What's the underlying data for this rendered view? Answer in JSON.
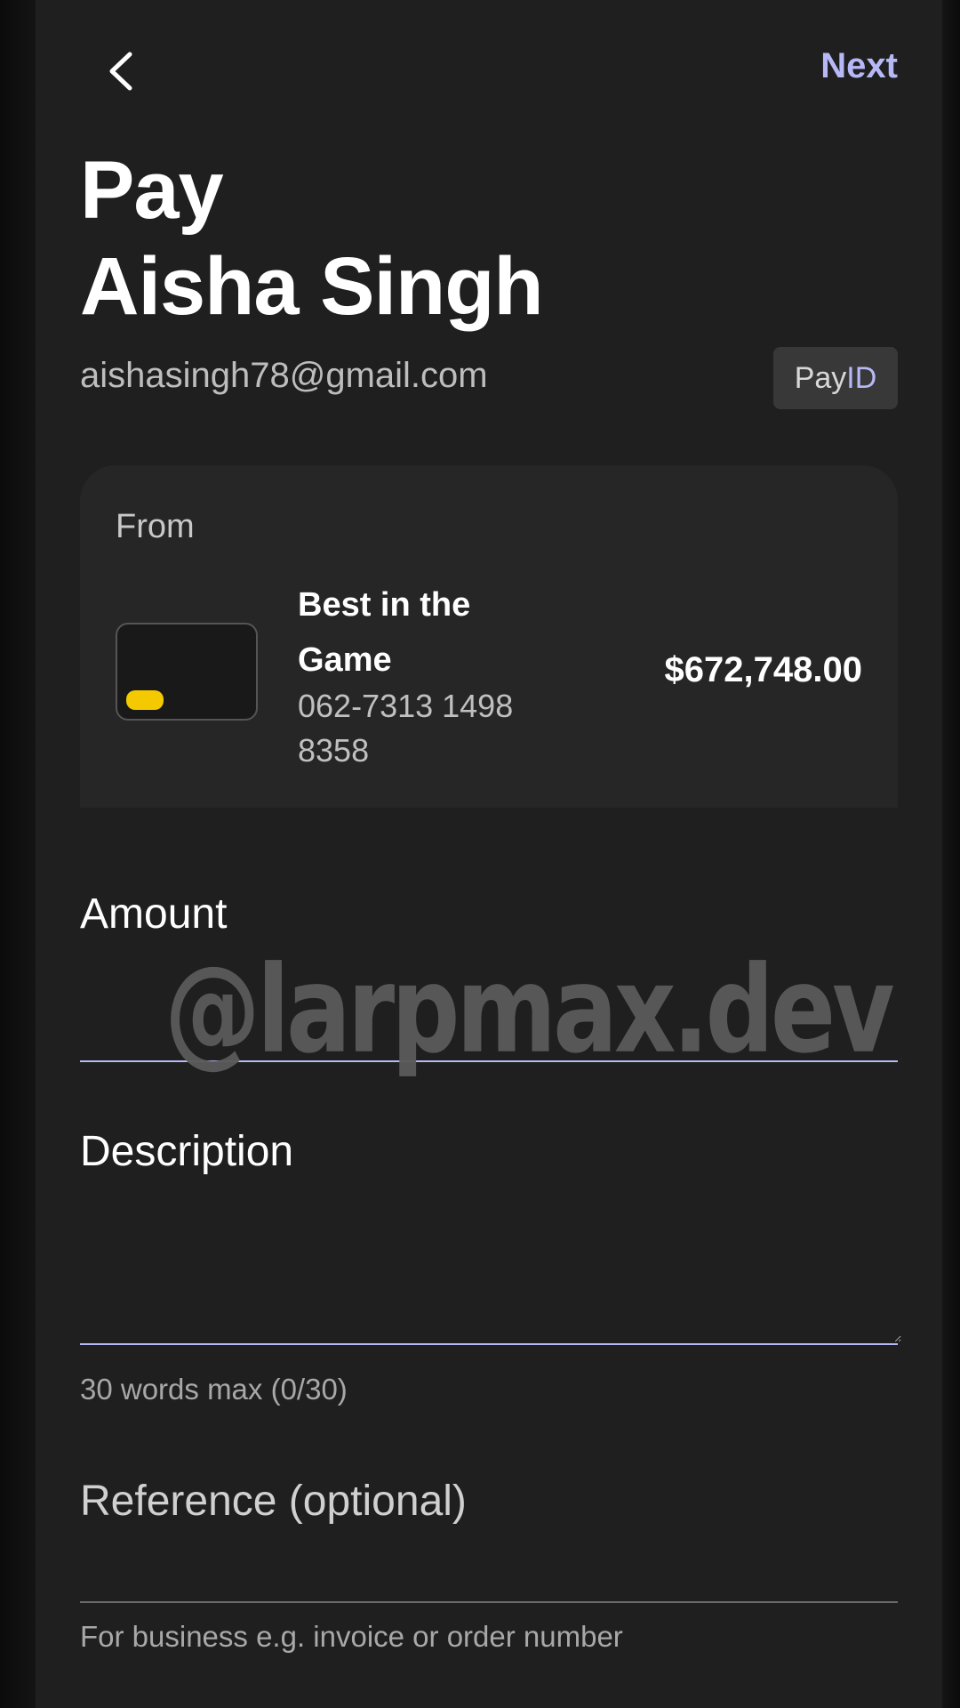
{
  "header": {
    "back_icon": "chevron-left-icon",
    "next_label": "Next"
  },
  "title": {
    "line1": "Pay",
    "line2": "Aisha Singh"
  },
  "payee": {
    "email": "aishasingh78@gmail.com",
    "badge_pay": "Pay",
    "badge_id": "ID"
  },
  "from": {
    "label": "From",
    "account_name": "Best in the Game",
    "account_number": "062-7313 1498 8358",
    "balance": "$672,748.00",
    "card_icon": "card-icon"
  },
  "amount": {
    "label": "Amount",
    "value": ""
  },
  "description": {
    "label": "Description",
    "value": "",
    "hint": "30 words max (0/30)"
  },
  "reference": {
    "label": "Reference (optional)",
    "value": "",
    "hint": "For business e.g. invoice or order number"
  },
  "watermark": "@larpmax.dev",
  "colors": {
    "accent": "#b7b9f7",
    "background": "#1f1f1f",
    "card": "#262626",
    "chip": "#f5c900"
  }
}
